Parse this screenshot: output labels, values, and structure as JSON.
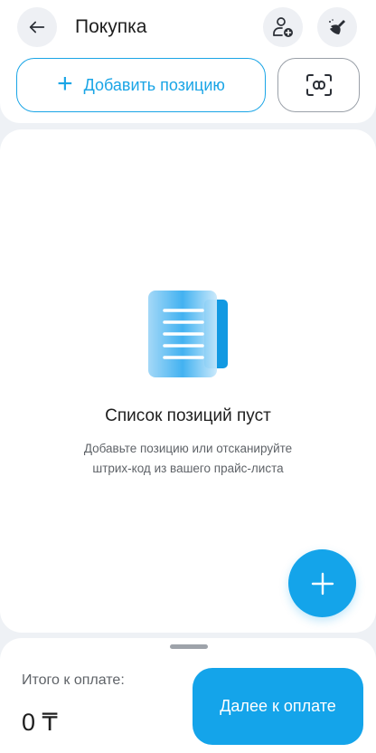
{
  "header": {
    "title": "Покупка",
    "back_icon": "arrow-left-icon",
    "add_person_icon": "person-add-icon",
    "clean_icon": "broom-icon"
  },
  "actions": {
    "add_position_label": "Добавить позицию",
    "scan_icon": "barcode-scan-icon"
  },
  "empty_state": {
    "title": "Список позиций пуст",
    "subtitle_line1": "Добавьте позицию или отсканируйте",
    "subtitle_line2": "штрих-код из вашего прайс-листа"
  },
  "footer": {
    "total_label": "Итого к оплате:",
    "total_value": "0 ₸",
    "pay_button_label": "Далее к оплате"
  },
  "colors": {
    "accent": "#14a4ea",
    "background": "#eef1f5",
    "card": "#ffffff",
    "text_secondary": "#5f6368"
  }
}
